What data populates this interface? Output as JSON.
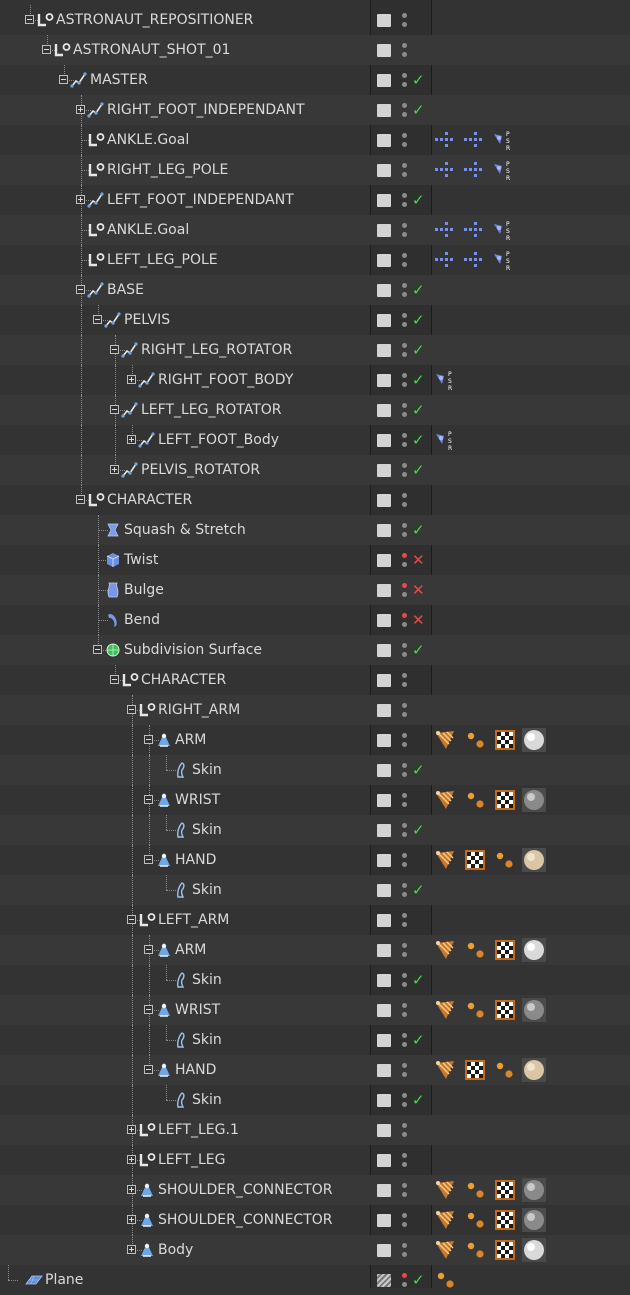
{
  "palette": {
    "panel": "#333333",
    "row_alt": "#383838",
    "text": "#d9d9d9",
    "check": "#4bd34b",
    "cross": "#e84a4a",
    "null_icon": "#e6e6e6",
    "joint_icon": "#6fa7e6",
    "ik_tag": "#7b8ff0"
  },
  "rows": [
    {
      "label": "ASTRONAUT_REPOSITIONER",
      "depth": 1,
      "icon": "null-object-icon",
      "exp": "open",
      "status": "",
      "tags": []
    },
    {
      "label": "ASTRONAUT_SHOT_01",
      "depth": 2,
      "icon": "null-object-icon",
      "exp": "open",
      "status": "",
      "tags": []
    },
    {
      "label": "MASTER",
      "depth": 3,
      "icon": "spline-icon",
      "exp": "open",
      "status": "check",
      "tags": []
    },
    {
      "label": "RIGHT_FOOT_INDEPENDANT",
      "depth": 4,
      "icon": "spline-icon",
      "exp": "closed",
      "status": "check",
      "tags": []
    },
    {
      "label": "ANKLE.Goal",
      "depth": 4,
      "icon": "null-object-icon",
      "exp": "",
      "status": "",
      "tags": [
        "ik-tag-icon",
        "ik-tag-icon",
        "pose-tag-icon"
      ]
    },
    {
      "label": "RIGHT_LEG_POLE",
      "depth": 4,
      "icon": "null-object-icon",
      "exp": "",
      "status": "",
      "tags": [
        "ik-tag-icon",
        "ik-tag-icon",
        "pose-tag-icon"
      ]
    },
    {
      "label": "LEFT_FOOT_INDEPENDANT",
      "depth": 4,
      "icon": "spline-icon",
      "exp": "closed",
      "status": "check",
      "tags": []
    },
    {
      "label": "ANKLE.Goal",
      "depth": 4,
      "icon": "null-object-icon",
      "exp": "",
      "status": "",
      "tags": [
        "ik-tag-icon",
        "ik-tag-icon",
        "pose-tag-icon"
      ]
    },
    {
      "label": "LEFT_LEG_POLE",
      "depth": 4,
      "icon": "null-object-icon",
      "exp": "",
      "status": "",
      "tags": [
        "ik-tag-icon",
        "ik-tag-icon",
        "pose-tag-icon"
      ]
    },
    {
      "label": "BASE",
      "depth": 4,
      "icon": "spline-icon",
      "exp": "open",
      "status": "check",
      "tags": []
    },
    {
      "label": "PELVIS",
      "depth": 5,
      "icon": "spline-icon",
      "exp": "open",
      "status": "check",
      "tags": []
    },
    {
      "label": "RIGHT_LEG_ROTATOR",
      "depth": 6,
      "icon": "spline-icon",
      "exp": "open",
      "status": "check",
      "tags": []
    },
    {
      "label": "RIGHT_FOOT_BODY",
      "depth": 7,
      "icon": "spline-icon",
      "exp": "closed",
      "status": "check",
      "tags": [
        "pose-tag-icon"
      ]
    },
    {
      "label": "LEFT_LEG_ROTATOR",
      "depth": 6,
      "icon": "spline-icon",
      "exp": "open",
      "status": "check",
      "tags": []
    },
    {
      "label": "LEFT_FOOT_Body",
      "depth": 7,
      "icon": "spline-icon",
      "exp": "closed",
      "status": "check",
      "tags": [
        "pose-tag-icon"
      ]
    },
    {
      "label": "PELVIS_ROTATOR",
      "depth": 6,
      "icon": "spline-icon",
      "exp": "closed",
      "status": "check",
      "tags": []
    },
    {
      "label": "CHARACTER",
      "depth": 4,
      "icon": "null-object-icon",
      "exp": "open",
      "status": "",
      "tags": []
    },
    {
      "label": "Squash & Stretch",
      "depth": 5,
      "icon": "squash-deformer-icon",
      "exp": "",
      "status": "check",
      "tags": []
    },
    {
      "label": "Twist",
      "depth": 5,
      "icon": "twist-deformer-icon",
      "exp": "",
      "status": "cross",
      "red": true,
      "tags": []
    },
    {
      "label": "Bulge",
      "depth": 5,
      "icon": "bulge-deformer-icon",
      "exp": "",
      "status": "cross",
      "red": true,
      "tags": []
    },
    {
      "label": "Bend",
      "depth": 5,
      "icon": "bend-deformer-icon",
      "exp": "",
      "status": "cross",
      "red": true,
      "tags": []
    },
    {
      "label": "Subdivision Surface",
      "depth": 5,
      "icon": "subdivision-surface-icon",
      "exp": "open",
      "status": "check",
      "tags": []
    },
    {
      "label": "CHARACTER",
      "depth": 6,
      "icon": "null-object-icon",
      "exp": "open",
      "status": "",
      "tags": []
    },
    {
      "label": "RIGHT_ARM",
      "depth": 7,
      "icon": "null-object-icon",
      "exp": "open",
      "status": "",
      "tags": []
    },
    {
      "label": "ARM",
      "depth": 8,
      "icon": "joint-icon",
      "exp": "open",
      "status": "",
      "tags": [
        "weight-tag-icon",
        "vertex-map-tag-icon",
        "texture-tag-icon",
        "material-white-icon"
      ]
    },
    {
      "label": "Skin",
      "depth": 9,
      "icon": "skin-deformer-icon",
      "exp": "",
      "status": "check",
      "tags": []
    },
    {
      "label": "WRIST",
      "depth": 8,
      "icon": "joint-icon",
      "exp": "open",
      "status": "",
      "tags": [
        "weight-tag-icon",
        "vertex-map-tag-icon",
        "texture-tag-icon",
        "material-grey-icon"
      ]
    },
    {
      "label": "Skin",
      "depth": 9,
      "icon": "skin-deformer-icon",
      "exp": "",
      "status": "check",
      "tags": []
    },
    {
      "label": "HAND",
      "depth": 8,
      "icon": "joint-icon",
      "exp": "open",
      "status": "",
      "tags": [
        "weight-tag-icon",
        "texture-tag-icon",
        "vertex-map-tag-icon",
        "material-beige-icon"
      ]
    },
    {
      "label": "Skin",
      "depth": 9,
      "icon": "skin-deformer-icon",
      "exp": "",
      "status": "check",
      "tags": []
    },
    {
      "label": "LEFT_ARM",
      "depth": 7,
      "icon": "null-object-icon",
      "exp": "open",
      "status": "",
      "tags": []
    },
    {
      "label": "ARM",
      "depth": 8,
      "icon": "joint-icon",
      "exp": "open",
      "status": "",
      "tags": [
        "weight-tag-icon",
        "vertex-map-tag-icon",
        "texture-tag-icon",
        "material-white-icon"
      ]
    },
    {
      "label": "Skin",
      "depth": 9,
      "icon": "skin-deformer-icon",
      "exp": "",
      "status": "check",
      "tags": []
    },
    {
      "label": "WRIST",
      "depth": 8,
      "icon": "joint-icon",
      "exp": "open",
      "status": "",
      "tags": [
        "weight-tag-icon",
        "vertex-map-tag-icon",
        "texture-tag-icon",
        "material-grey-icon"
      ]
    },
    {
      "label": "Skin",
      "depth": 9,
      "icon": "skin-deformer-icon",
      "exp": "",
      "status": "check",
      "tags": []
    },
    {
      "label": "HAND",
      "depth": 8,
      "icon": "joint-icon",
      "exp": "open",
      "status": "",
      "tags": [
        "weight-tag-icon",
        "texture-tag-icon",
        "vertex-map-tag-icon",
        "material-beige-icon"
      ]
    },
    {
      "label": "Skin",
      "depth": 9,
      "icon": "skin-deformer-icon",
      "exp": "",
      "status": "check",
      "tags": []
    },
    {
      "label": "LEFT_LEG.1",
      "depth": 7,
      "icon": "null-object-icon",
      "exp": "closed",
      "status": "",
      "tags": []
    },
    {
      "label": "LEFT_LEG",
      "depth": 7,
      "icon": "null-object-icon",
      "exp": "closed",
      "status": "",
      "tags": []
    },
    {
      "label": "SHOULDER_CONNECTOR",
      "depth": 7,
      "icon": "joint-icon",
      "exp": "closed",
      "status": "",
      "tags": [
        "weight-tag-icon",
        "vertex-map-tag-icon",
        "texture-tag-icon",
        "material-grey-icon"
      ]
    },
    {
      "label": "SHOULDER_CONNECTOR",
      "depth": 7,
      "icon": "joint-icon",
      "exp": "closed",
      "status": "",
      "tags": [
        "weight-tag-icon",
        "vertex-map-tag-icon",
        "texture-tag-icon",
        "material-grey-icon"
      ]
    },
    {
      "label": "Body",
      "depth": 7,
      "icon": "joint-icon",
      "exp": "closed",
      "status": "",
      "tags": [
        "weight-tag-icon",
        "vertex-map-tag-icon",
        "texture-tag-icon",
        "material-white-icon"
      ]
    },
    {
      "label": "Plane",
      "depth": 0,
      "icon": "plane-icon",
      "exp": "",
      "status": "check",
      "red": true,
      "hatched": true,
      "tags": [
        "vertex-map-tag-icon"
      ]
    }
  ]
}
